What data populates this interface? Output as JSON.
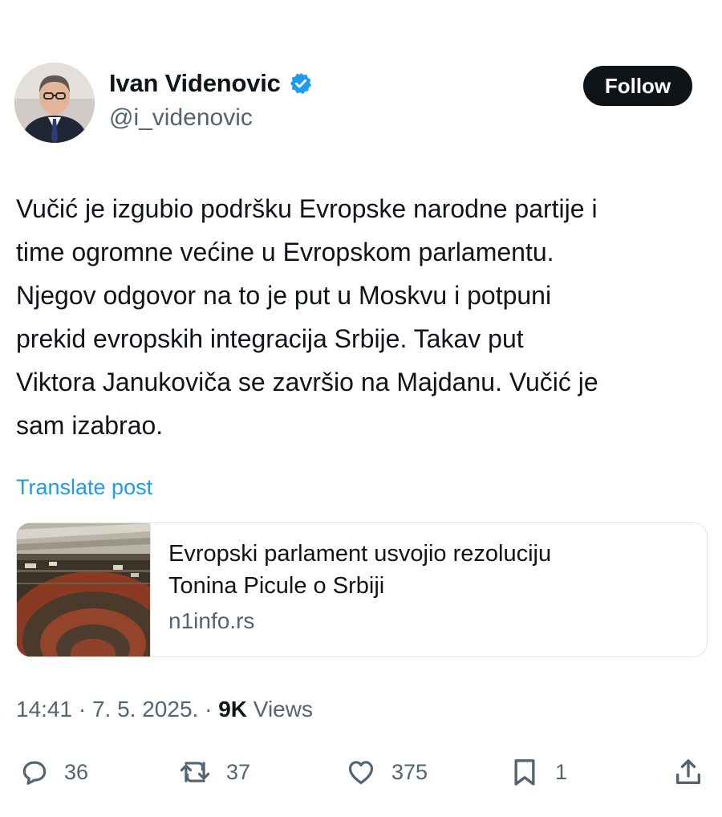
{
  "author": {
    "name": "Ivan Videnovic",
    "handle": "@i_videnovic",
    "verified_color": "#1d9bf0"
  },
  "follow_label": "Follow",
  "post": {
    "lines": [
      "Vučić je izgubio podršku Evropske narodne partije i",
      "time ogromne većine u Evropskom parlamentu.",
      "Njegov odgovor na to je put u Moskvu i potpuni",
      "prekid evropskih integracija Srbije. Takav put",
      "Viktora Janukoviča se završio na Majdanu. Vučić je",
      "sam izabrao."
    ],
    "translate_label": "Translate post"
  },
  "link_card": {
    "title_lines": [
      "Evropski parlament usvojio rezoluciju",
      "Tonina Picule o Srbiji"
    ],
    "domain": "n1info.rs"
  },
  "meta": {
    "time": "14:41",
    "separator": " · ",
    "date": "7. 5. 2025.",
    "views_count": "9K",
    "views_label": "Views"
  },
  "actions": {
    "replies": "36",
    "reposts": "37",
    "likes": "375",
    "bookmarks": "1"
  },
  "icons": [
    "verified-badge-icon",
    "reply-icon",
    "repost-icon",
    "like-icon",
    "bookmark-icon",
    "share-icon"
  ],
  "colors": {
    "text": "#0f1419",
    "secondary": "#536471",
    "link": "#1d9bf0",
    "follow_bg": "#0f1419"
  }
}
